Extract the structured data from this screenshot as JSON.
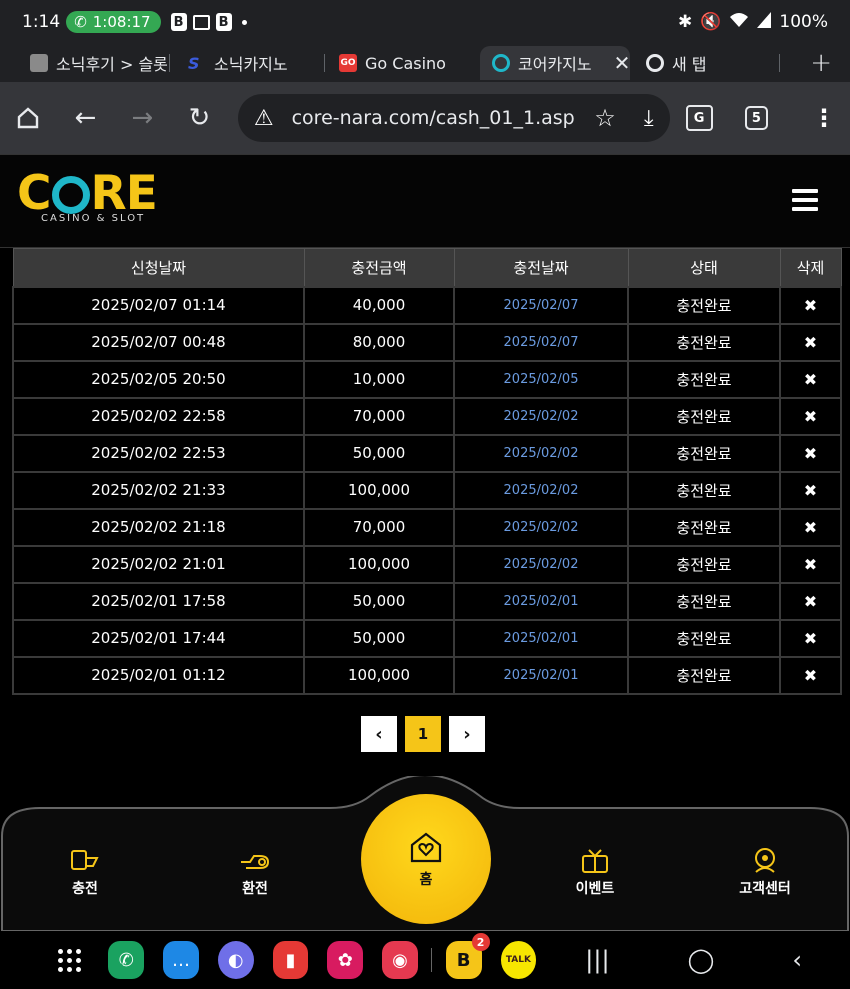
{
  "status": {
    "time": "1:14",
    "call_timer": "1:08:17",
    "battery": "100%",
    "icons": [
      "bluetooth-icon",
      "mute-icon",
      "wifi-icon",
      "signal-icon"
    ]
  },
  "tabs": [
    {
      "label": "소닉후기 > 슬롯",
      "favicon_color": "#8a8a8a"
    },
    {
      "label": "소닉카지노",
      "favicon_color": "#3b5bdb"
    },
    {
      "label": "Go Casino",
      "favicon_color": "#e53935"
    },
    {
      "label": "코어카지노",
      "favicon_color": "#1fb7c9",
      "active": true
    },
    {
      "label": "새 탭",
      "favicon_color": "#e8eaed"
    }
  ],
  "toolbar": {
    "url": "core-nara.com/cash_01_1.asp",
    "tab_count": "5"
  },
  "site": {
    "logo_text": "CORE",
    "logo_subtext": "CASINO & SLOT"
  },
  "table": {
    "headers": [
      "신청날짜",
      "충전금액",
      "충전날짜",
      "상태",
      "삭제"
    ],
    "rows": [
      {
        "requested": "2025/02/07 01:14",
        "amount": "40,000",
        "charged": "2025/02/07",
        "status": "충전완료"
      },
      {
        "requested": "2025/02/07 00:48",
        "amount": "80,000",
        "charged": "2025/02/07",
        "status": "충전완료"
      },
      {
        "requested": "2025/02/05 20:50",
        "amount": "10,000",
        "charged": "2025/02/05",
        "status": "충전완료"
      },
      {
        "requested": "2025/02/02 22:58",
        "amount": "70,000",
        "charged": "2025/02/02",
        "status": "충전완료"
      },
      {
        "requested": "2025/02/02 22:53",
        "amount": "50,000",
        "charged": "2025/02/02",
        "status": "충전완료"
      },
      {
        "requested": "2025/02/02 21:33",
        "amount": "100,000",
        "charged": "2025/02/02",
        "status": "충전완료"
      },
      {
        "requested": "2025/02/02 21:18",
        "amount": "70,000",
        "charged": "2025/02/02",
        "status": "충전완료"
      },
      {
        "requested": "2025/02/02 21:01",
        "amount": "100,000",
        "charged": "2025/02/02",
        "status": "충전완료"
      },
      {
        "requested": "2025/02/01 17:58",
        "amount": "50,000",
        "charged": "2025/02/01",
        "status": "충전완료"
      },
      {
        "requested": "2025/02/01 17:44",
        "amount": "50,000",
        "charged": "2025/02/01",
        "status": "충전완료"
      },
      {
        "requested": "2025/02/01 01:12",
        "amount": "100,000",
        "charged": "2025/02/01",
        "status": "충전완료"
      }
    ],
    "delete_glyph": "✖"
  },
  "pagination": {
    "prev": "‹",
    "current": "1",
    "next": "›"
  },
  "bottom_nav": {
    "deposit": "충전",
    "withdraw": "환전",
    "home": "홈",
    "event": "이벤트",
    "support": "고객센터"
  },
  "system_apps": {
    "badge_count": "2",
    "kakao_label": "TALK"
  },
  "colors": {
    "accent": "#f5c518",
    "logo_ring": "#1fb7c9",
    "date_link": "#6b9be0"
  }
}
